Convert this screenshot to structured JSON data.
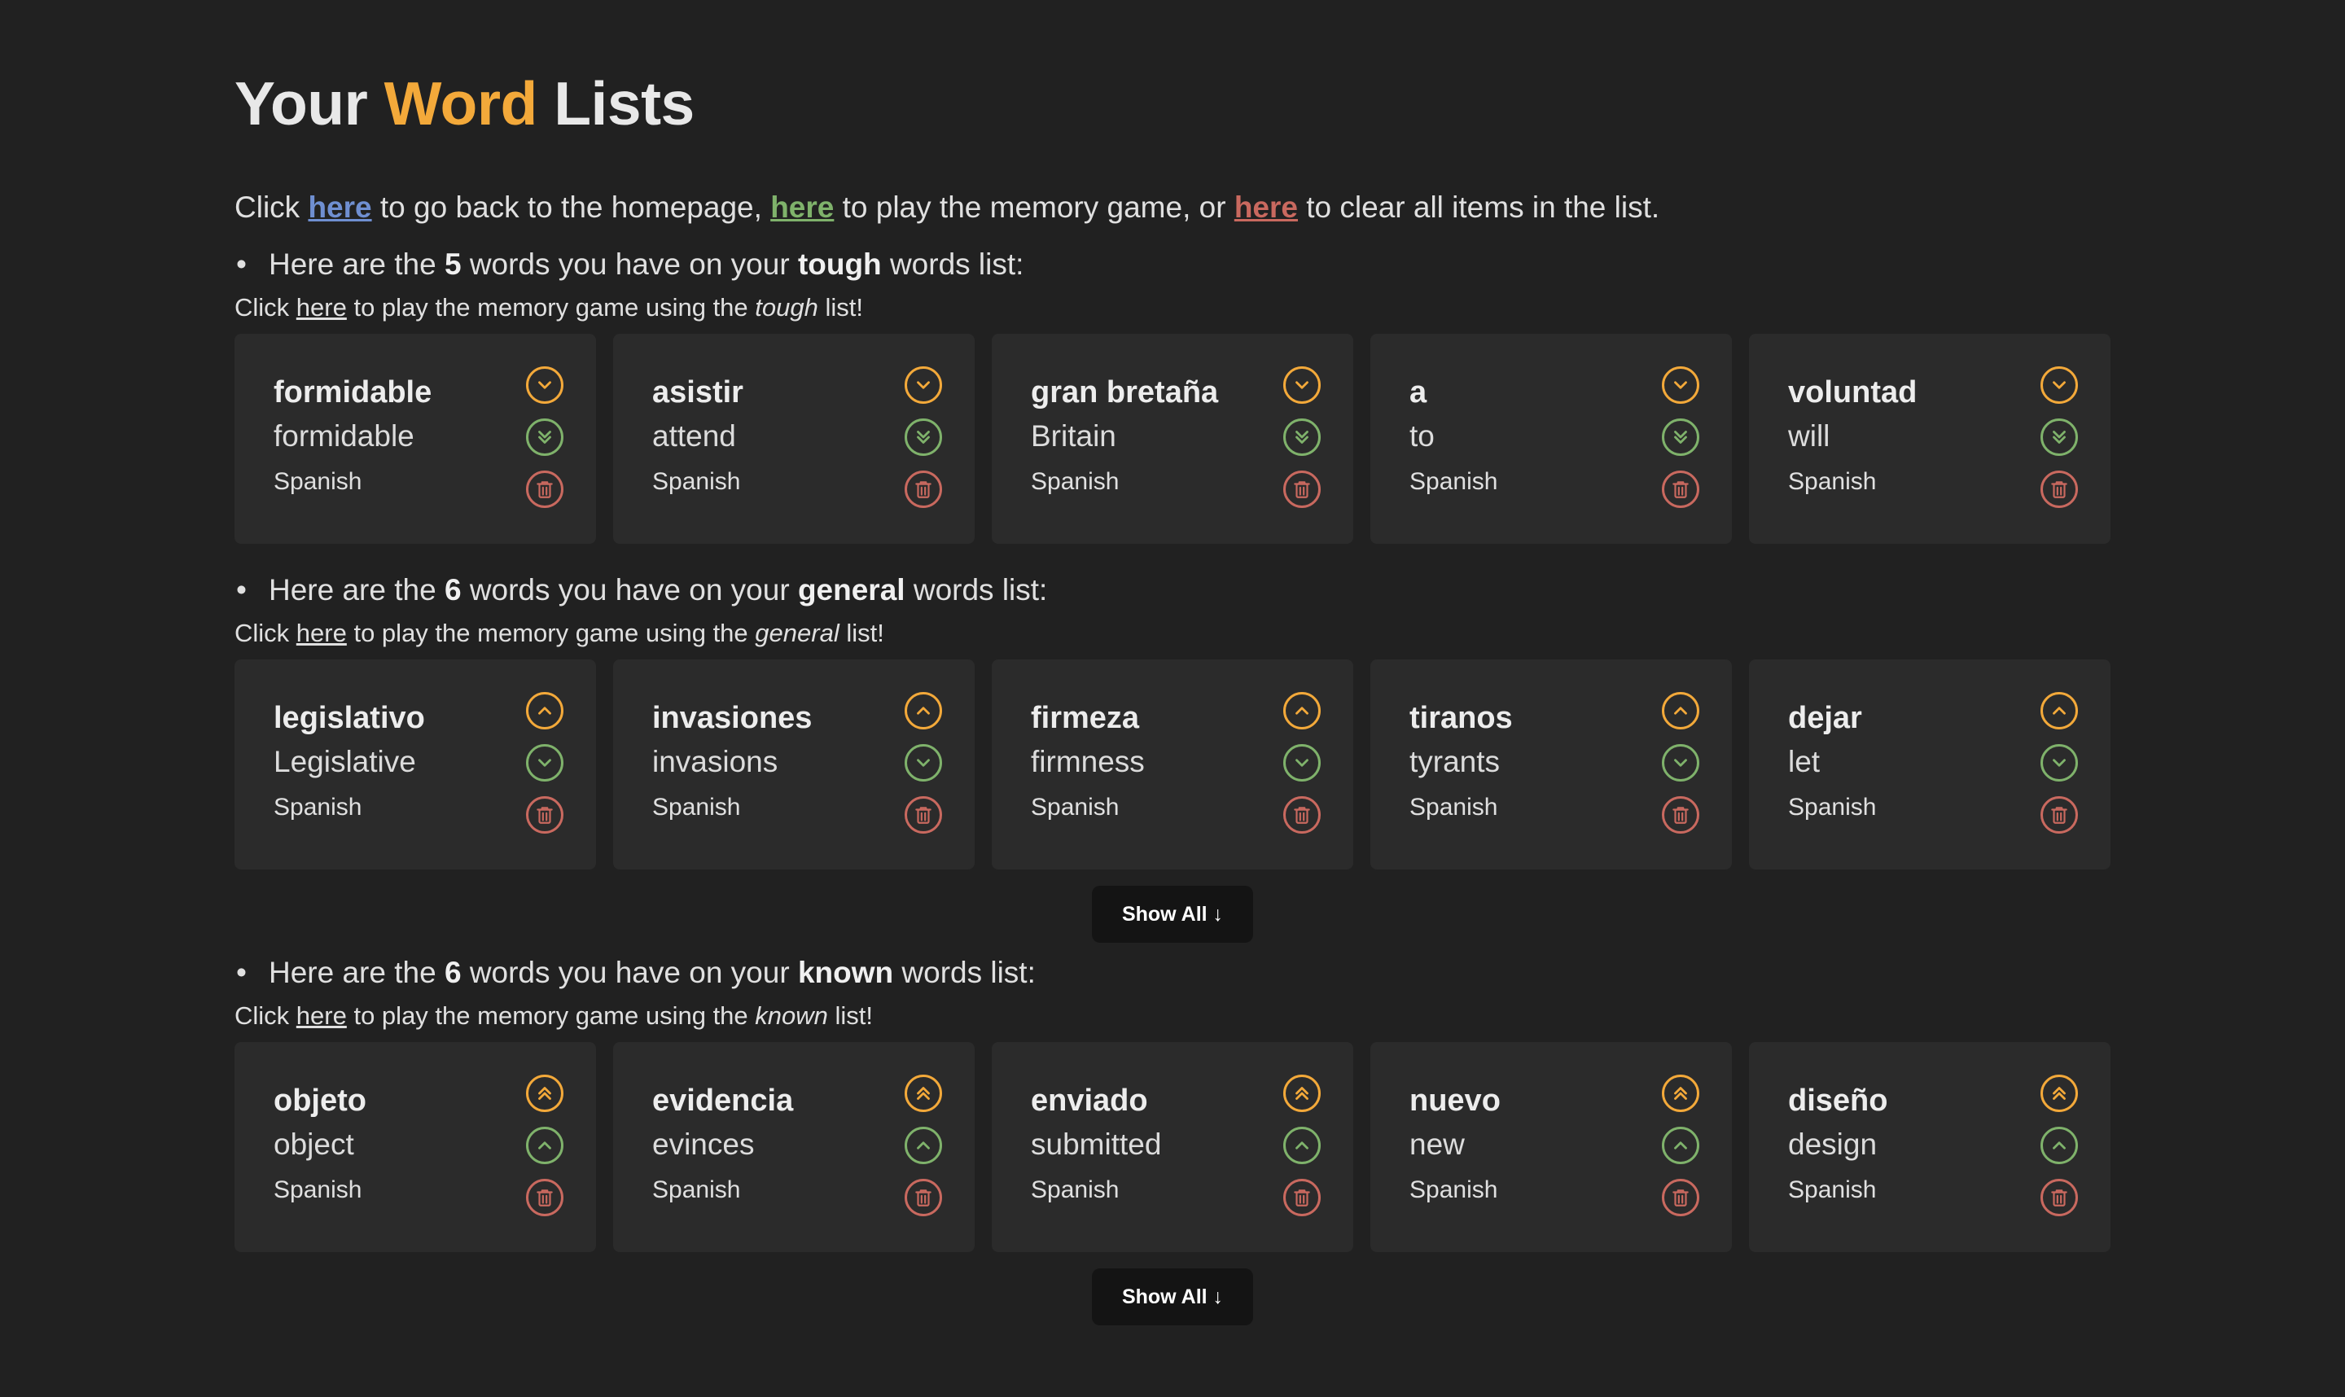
{
  "header": {
    "title_part1": "Your",
    "title_accent": "Word",
    "title_part2": "Lists"
  },
  "intro": {
    "t1": "Click",
    "link_home": "here",
    "t2": "to go back to the homepage,",
    "link_game": "here",
    "t3": "to play the memory game, or",
    "link_clear": "here",
    "t4": "to clear all items in the list."
  },
  "common": {
    "bullet_prefix": "Here are the",
    "bullet_middle": "words you have on your",
    "bullet_suffix": "words list:",
    "sub_prefix": "Click",
    "sub_link": "here",
    "sub_middle": "to play the memory game using the",
    "sub_suffix": "list!",
    "show_all": "Show All ↓"
  },
  "colors": {
    "accent": "#f3a93a",
    "green": "#7fb26b",
    "red": "#c9695f",
    "blue": "#6f8fd1"
  },
  "lists": [
    {
      "name": "tough",
      "count": "5",
      "icons": [
        "chevron-down-icon",
        "double-chevron-down-icon",
        "trash-icon"
      ],
      "words": [
        {
          "word": "formidable",
          "translation": "formidable",
          "language": "Spanish"
        },
        {
          "word": "asistir",
          "translation": "attend",
          "language": "Spanish"
        },
        {
          "word": "gran bretaña",
          "translation": "Britain",
          "language": "Spanish"
        },
        {
          "word": "a",
          "translation": "to",
          "language": "Spanish"
        },
        {
          "word": "voluntad",
          "translation": "will",
          "language": "Spanish"
        }
      ]
    },
    {
      "name": "general",
      "count": "6",
      "icons": [
        "chevron-up-icon",
        "chevron-down-icon",
        "trash-icon"
      ],
      "words": [
        {
          "word": "legislativo",
          "translation": "Legislative",
          "language": "Spanish"
        },
        {
          "word": "invasiones",
          "translation": "invasions",
          "language": "Spanish"
        },
        {
          "word": "firmeza",
          "translation": "firmness",
          "language": "Spanish"
        },
        {
          "word": "tiranos",
          "translation": "tyrants",
          "language": "Spanish"
        },
        {
          "word": "dejar",
          "translation": "let",
          "language": "Spanish"
        }
      ]
    },
    {
      "name": "known",
      "count": "6",
      "icons": [
        "double-chevron-up-icon",
        "chevron-up-icon",
        "trash-icon"
      ],
      "words": [
        {
          "word": "objeto",
          "translation": "object",
          "language": "Spanish"
        },
        {
          "word": "evidencia",
          "translation": "evinces",
          "language": "Spanish"
        },
        {
          "word": "enviado",
          "translation": "submitted",
          "language": "Spanish"
        },
        {
          "word": "nuevo",
          "translation": "new",
          "language": "Spanish"
        },
        {
          "word": "diseño",
          "translation": "design",
          "language": "Spanish"
        }
      ]
    }
  ]
}
